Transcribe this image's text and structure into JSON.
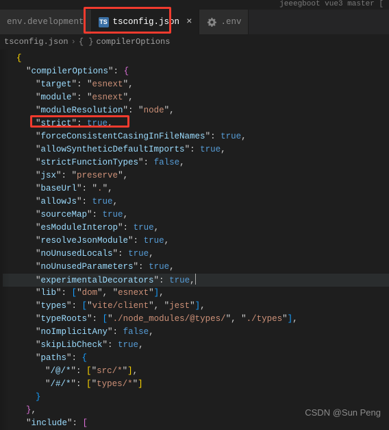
{
  "titleBar": "jeeegboot vue3 master [",
  "tabs": {
    "t0": {
      "label": "env.development"
    },
    "t1": {
      "label": "tsconfig.json",
      "icon": "TS"
    },
    "t2": {
      "label": ".env"
    }
  },
  "breadcrumb": {
    "file": "tsconfig.json",
    "sep": "›",
    "braces": "{ }",
    "section": "compilerOptions"
  },
  "code": {
    "compilerOptions": "compilerOptions",
    "target": "target",
    "target_v": "esnext",
    "module": "module",
    "module_v": "esnext",
    "moduleResolution": "moduleResolution",
    "moduleResolution_v": "node",
    "strict": "strict",
    "strict_v": "true",
    "forceConsistent": "forceConsistentCasingInFileNames",
    "forceConsistent_v": "true",
    "allowSynthetic": "allowSyntheticDefaultImports",
    "allowSynthetic_v": "true",
    "strictFunctionTypes": "strictFunctionTypes",
    "strictFunctionTypes_v": "false",
    "jsx": "jsx",
    "jsx_v": "preserve",
    "baseUrl": "baseUrl",
    "baseUrl_v": ".",
    "allowJs": "allowJs",
    "allowJs_v": "true",
    "sourceMap": "sourceMap",
    "sourceMap_v": "true",
    "esModuleInterop": "esModuleInterop",
    "esModuleInterop_v": "true",
    "resolveJsonModule": "resolveJsonModule",
    "resolveJsonModule_v": "true",
    "noUnusedLocals": "noUnusedLocals",
    "noUnusedLocals_v": "true",
    "noUnusedParameters": "noUnusedParameters",
    "noUnusedParameters_v": "true",
    "experimentalDecorators": "experimentalDecorators",
    "experimentalDecorators_v": "true",
    "lib": "lib",
    "lib_0": "dom",
    "lib_1": "esnext",
    "types": "types",
    "types_0": "vite/client",
    "types_1": "jest",
    "typeRoots": "typeRoots",
    "typeRoots_0": "./node_modules/@types/",
    "typeRoots_1": "./types",
    "noImplicitAny": "noImplicitAny",
    "noImplicitAny_v": "false",
    "skipLibCheck": "skipLibCheck",
    "skipLibCheck_v": "true",
    "paths": "paths",
    "path_at": "/@/*",
    "path_at_v": "src/*",
    "path_hash": "/#/*",
    "path_hash_v": "types/*",
    "include": "include"
  },
  "watermark": "CSDN @Sun  Peng"
}
